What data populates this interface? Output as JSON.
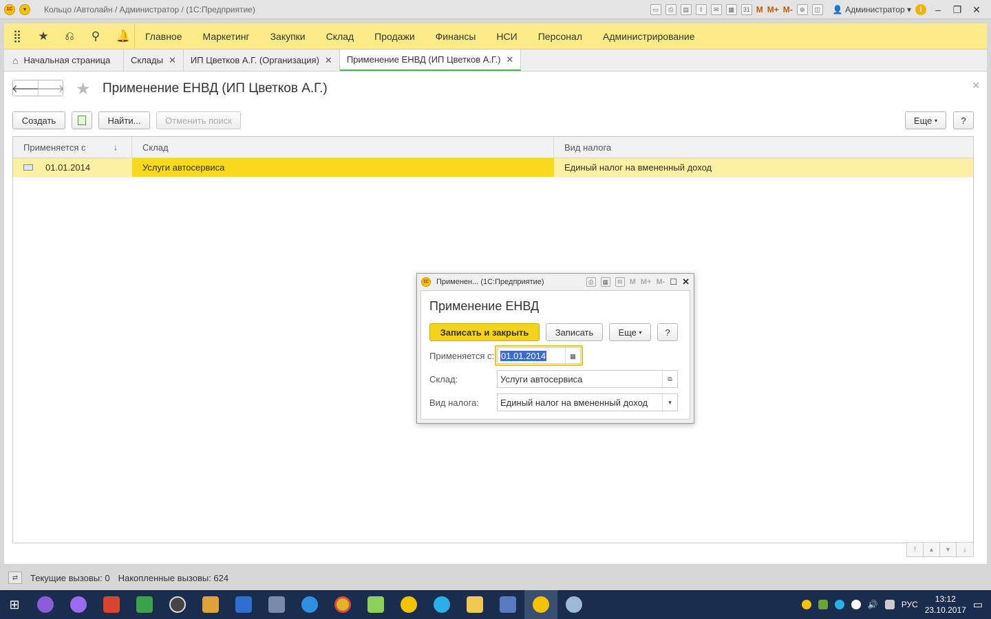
{
  "window": {
    "title": "Кольцо /Автолайн / Администратор /  (1С:Предприятие)",
    "user": "Администратор",
    "m_buttons": [
      "M",
      "M+",
      "M-"
    ]
  },
  "menu": {
    "items": [
      "Главное",
      "Маркетинг",
      "Закупки",
      "Склад",
      "Продажи",
      "Финансы",
      "НСИ",
      "Персонал",
      "Администрирование"
    ]
  },
  "tabs": [
    {
      "label": "Начальная страница"
    },
    {
      "label": "Склады"
    },
    {
      "label": "ИП Цветков А.Г. (Организация)"
    },
    {
      "label": "Применение ЕНВД (ИП Цветков А.Г.)"
    }
  ],
  "page": {
    "title": "Применение ЕНВД (ИП Цветков А.Г.)",
    "create_label": "Создать",
    "find_label": "Найти...",
    "cancel_search_label": "Отменить поиск",
    "more_label": "Еще",
    "help_label": "?"
  },
  "table": {
    "columns": [
      "Применяется с",
      "Склад",
      "Вид налога"
    ],
    "rows": [
      {
        "date": "01.01.2014",
        "warehouse": "Услуги автосервиса",
        "tax": "Единый налог на вмененный доход"
      }
    ]
  },
  "status": {
    "current_calls": "Текущие вызовы: 0",
    "accum_calls": "Накопленные вызовы: 624"
  },
  "dialog": {
    "window_title": "Применен...  (1С:Предприятие)",
    "heading": "Применение ЕНВД",
    "save_close_label": "Записать и закрыть",
    "save_label": "Записать",
    "more_label": "Еще",
    "help_label": "?",
    "fields": {
      "date_label": "Применяется с:",
      "date_value": "01.01.2014",
      "warehouse_label": "Склад:",
      "warehouse_value": "Услуги автосервиса",
      "tax_label": "Вид налога:",
      "tax_value": "Единый налог на вмененный доход"
    }
  },
  "taskbar": {
    "lang": "РУС",
    "time": "13:12",
    "date": "23.10.2017"
  },
  "colors": {
    "menu_bg": "#fbec88",
    "row_selected": "#f9d81e",
    "row_bg": "#fbf0a2",
    "primary_button": "#f5d31a",
    "taskbar": "#1b2d4f"
  }
}
